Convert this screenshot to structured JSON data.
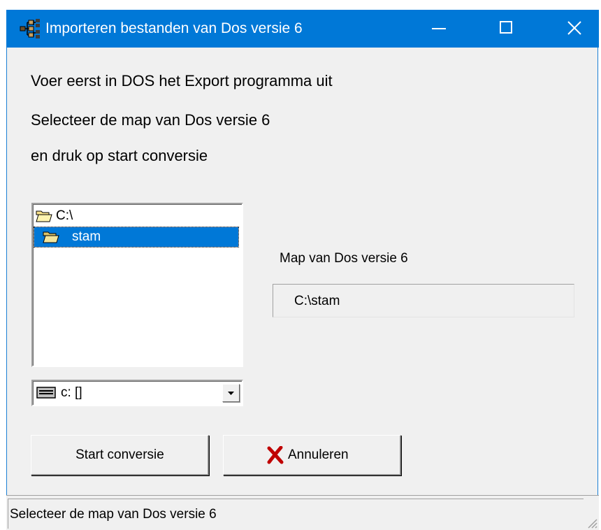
{
  "window": {
    "title": "Importeren bestanden van Dos versie 6",
    "icon": "family-tree-icon",
    "controls": [
      "minimize-icon",
      "maximize-icon",
      "close-icon"
    ]
  },
  "instructions": [
    "Voer eerst in DOS het Export programma uit",
    "Selecteer de map van Dos versie 6",
    "en druk op start conversie"
  ],
  "folder_tree": {
    "root": "C:\\",
    "selected": "stam"
  },
  "drive_select": {
    "value": "c: []",
    "icon": "drive-icon"
  },
  "target": {
    "label": "Map van Dos versie 6",
    "value": "C:\\stam"
  },
  "buttons": {
    "start": "Start conversie",
    "cancel": "Annuleren",
    "cancel_icon": "red-x-icon"
  },
  "status": {
    "text": "Selecteer de map van Dos versie 6"
  },
  "colors": {
    "titlebar": "#0078d7",
    "selection": "#0078d7",
    "window_bg": "#f0f0f0",
    "cancel_icon": "#c00000"
  }
}
